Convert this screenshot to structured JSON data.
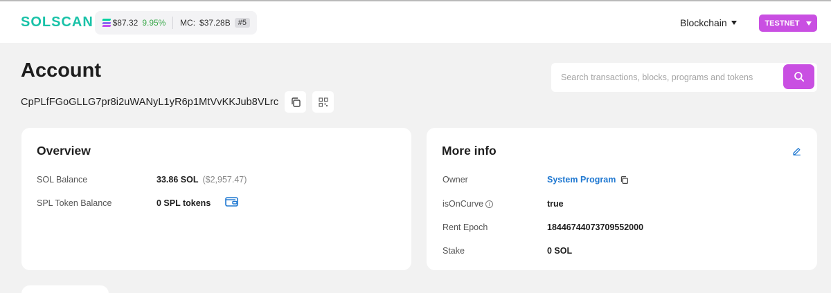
{
  "header": {
    "logo": "SOLSCAN",
    "price": "$87.32",
    "price_change": "9.95%",
    "mc_label": "MC:",
    "market_cap": "$37.28B",
    "rank": "#5",
    "blockchain_menu": "Blockchain",
    "network": "TESTNET"
  },
  "page": {
    "title": "Account",
    "address": "CpPLfFGoGLLG7pr8i2uWANyL1yR6p1MtVvKKJub8VLrc"
  },
  "search": {
    "placeholder": "Search transactions, blocks, programs and tokens"
  },
  "overview": {
    "title": "Overview",
    "sol_balance_label": "SOL Balance",
    "sol_balance_value": "33.86 SOL",
    "sol_balance_usd": "($2,957.47)",
    "spl_label": "SPL Token Balance",
    "spl_value": "0 SPL tokens"
  },
  "more_info": {
    "title": "More info",
    "owner_label": "Owner",
    "owner_value": "System Program",
    "oncurve_label": "isOnCurve",
    "oncurve_value": "true",
    "rent_label": "Rent Epoch",
    "rent_value": "18446744073709552000",
    "stake_label": "Stake",
    "stake_value": "0 SOL"
  },
  "colors": {
    "brand": "#19c2a8",
    "accent": "#c94fe2",
    "positive": "#3aa84a",
    "link": "#1f78d1"
  },
  "icons": [
    "solana-icon",
    "caret-down-icon",
    "copy-icon",
    "qr-code-icon",
    "search-icon",
    "wallet-icon",
    "info-icon",
    "edit-icon"
  ]
}
